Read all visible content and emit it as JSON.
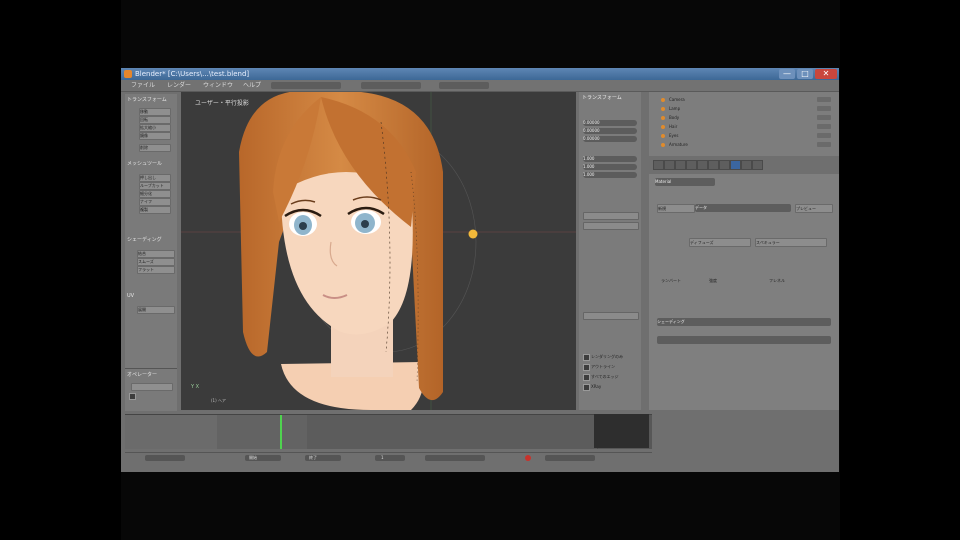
{
  "window": {
    "title": "Blender* [C:\\Users\\...\\test.blend]",
    "min_label": "—",
    "max_label": "□",
    "close_label": "✕"
  },
  "menubar": {
    "items": [
      "ファイル",
      "レンダー",
      "ウィンドウ",
      "ヘルプ"
    ]
  },
  "left_tools": {
    "sections": [
      "トランスフォーム",
      "メッシュツール",
      "シェーディング",
      "UV"
    ],
    "buttons": [
      "移動",
      "回転",
      "拡大縮小",
      "鏡像",
      "削除",
      "押し出し",
      "ループカット",
      "細分化",
      "ナイフ",
      "複製",
      "結合",
      "スムーズ",
      "フラット",
      "展開"
    ]
  },
  "redo": {
    "header": "オペレーター"
  },
  "viewport": {
    "label": "ユーザー・平行投影",
    "footer": "(1) ヘア",
    "gizmo": "Y X"
  },
  "props_panel": {
    "header": "トランスフォーム",
    "values": [
      "0.00000",
      "0.00000",
      "0.00000",
      "1.000",
      "1.000",
      "1.000"
    ],
    "checks": [
      "レンダリングのみ",
      "アウトライン",
      "すべてのエッジ",
      "XRay"
    ]
  },
  "outliner": {
    "items": [
      "Camera",
      "Lamp",
      "Body",
      "Hair",
      "Eyes",
      "Armature"
    ]
  },
  "material": {
    "name": "Material",
    "buttons": [
      "新規",
      "データ",
      "プレビュー",
      "ディフューズ",
      "スペキュラー"
    ],
    "rows": [
      "ランバート",
      "強度",
      "フレネル",
      "シェーディング"
    ]
  },
  "timeline": {
    "start": "開始",
    "end": "終了",
    "frame": "1"
  },
  "colors": {
    "accent": "#3b66a0",
    "playhead": "#4fd34f",
    "hair": "#c97937",
    "skin": "#f7d7be"
  }
}
